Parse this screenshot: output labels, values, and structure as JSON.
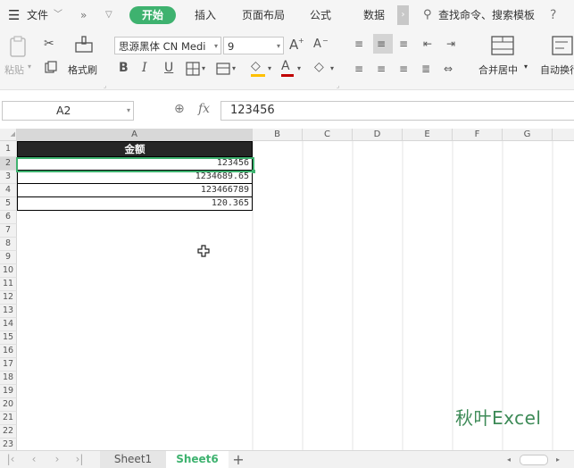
{
  "menu": {
    "hamburger_icon": "hamburger-menu-icon",
    "file_label": "文件",
    "tabs": [
      "开始",
      "插入",
      "页面布局",
      "公式",
      "数据"
    ],
    "active_tab": "开始",
    "search_placeholder": "查找命令、搜索模板",
    "help": "?"
  },
  "ribbon": {
    "paste_label": "粘贴",
    "format_painter_label": "格式刷",
    "font_name": "思源黑体 CN Medi",
    "font_size": "9",
    "bold": "B",
    "italic": "I",
    "underline": "U",
    "grow_font": "A",
    "shrink_font": "A",
    "merge_center_label": "合并居中",
    "wrap_label": "自动换行",
    "font_color": "#c00000",
    "fill_color": "#ffc000"
  },
  "formula_bar": {
    "name_box": "A2",
    "fx": "fx",
    "formula": "123456"
  },
  "grid": {
    "columns": [
      "A",
      "B",
      "C",
      "D",
      "E",
      "F",
      "G"
    ],
    "rows": [
      "1",
      "2",
      "3",
      "4",
      "5",
      "6",
      "7",
      "8",
      "9",
      "10",
      "11",
      "12",
      "13",
      "14",
      "15",
      "16",
      "17",
      "18",
      "19",
      "20",
      "21",
      "22",
      "23"
    ],
    "header_cell": "金额",
    "values": [
      "123456",
      "1234689.65",
      "123466789",
      "120.365"
    ],
    "selected_cell": "A2",
    "accent": "#3eb26f"
  },
  "sheets": {
    "tabs": [
      "Sheet1",
      "Sheet6"
    ],
    "active": "Sheet6",
    "add": "+"
  },
  "watermark": "秋叶Excel"
}
